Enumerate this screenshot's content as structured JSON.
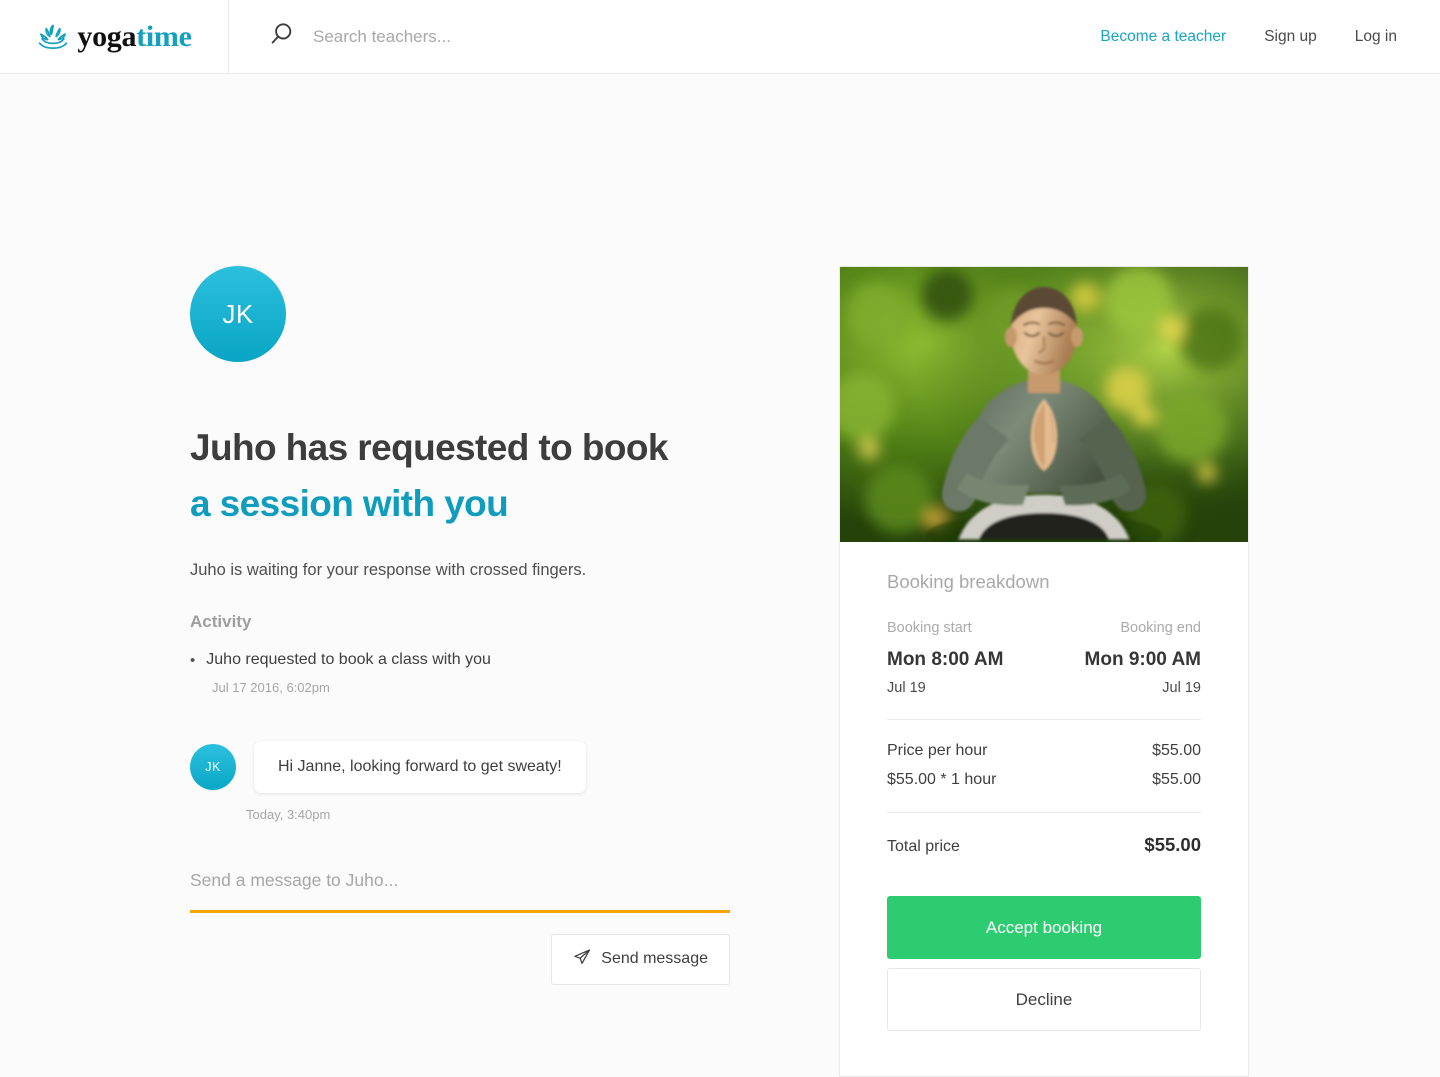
{
  "header": {
    "logo": {
      "icon": "lotus-icon",
      "word_primary": "yoga",
      "word_accent": "time"
    },
    "search": {
      "icon": "search-icon",
      "placeholder": "Search teachers...",
      "value": ""
    },
    "nav": [
      {
        "label": "Become a teacher",
        "accent": true
      },
      {
        "label": "Sign up",
        "accent": false
      },
      {
        "label": "Log in",
        "accent": false
      }
    ]
  },
  "request": {
    "avatar_initials": "JK",
    "headline_line1": "Juho has requested to book",
    "headline_line2": "a session with you",
    "subline": "Juho is waiting for your response with crossed fingers.",
    "activity_title": "Activity",
    "activity": [
      {
        "text": "Juho requested to book a class with you",
        "time": "Jul 17 2016, 6:02pm"
      }
    ],
    "message": {
      "avatar_initials": "JK",
      "text": "Hi Janne, looking forward to get sweaty!",
      "time": "Today, 3:40pm"
    },
    "composer": {
      "placeholder": "Send a message to Juho...",
      "value": "",
      "send_label": "Send message",
      "send_icon": "paper-plane-icon"
    }
  },
  "booking": {
    "photo_alt": "man-meditating-photo",
    "title": "Booking breakdown",
    "start_label": "Booking start",
    "end_label": "Booking end",
    "start_time": "Mon 8:00 AM",
    "end_time": "Mon 9:00 AM",
    "start_date": "Jul 19",
    "end_date": "Jul 19",
    "price_rows": [
      {
        "label": "Price per hour",
        "value": "$55.00"
      },
      {
        "label": "$55.00 * 1 hour",
        "value": "$55.00"
      }
    ],
    "total_label": "Total price",
    "total_value": "$55.00",
    "accept_label": "Accept booking",
    "decline_label": "Decline"
  },
  "colors": {
    "accent_teal": "#0f9cbd",
    "accent_orange": "#f5a406",
    "accept_green": "#2ecc71",
    "page_bg": "#fbfbfb"
  }
}
